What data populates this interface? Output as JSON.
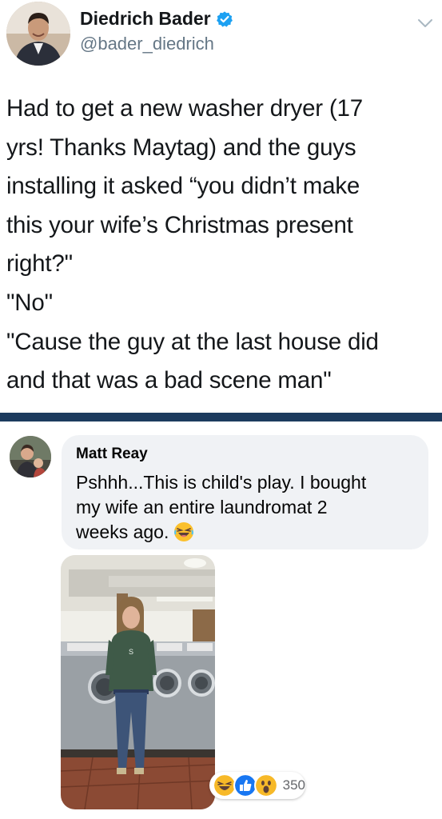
{
  "tweet": {
    "author_name": "Diedrich Bader",
    "handle": "@bader_diedrich",
    "lines": [
      "Had to get a new washer dryer (17",
      "yrs! Thanks Maytag) and the guys",
      "installing it asked “you didn’t make",
      "this your wife’s Christmas present",
      "right?\"",
      "\"No\"",
      "\"Cause the guy at the last house did",
      "and that was a bad scene man\""
    ]
  },
  "comment": {
    "author_name": "Matt Reay",
    "lines": [
      "Pshhh...This is child's play. I bought",
      "my wife an entire laundromat 2",
      "weeks ago."
    ],
    "reaction_count": "350"
  },
  "colors": {
    "divider": "#1c3b5e",
    "verified": "#1da1f2",
    "bubble": "#f0f2f5",
    "like": "#1877f2",
    "haha": "#f7b928"
  },
  "icons": [
    "verified-badge-icon",
    "chevron-down-icon",
    "laughing-emoji-icon",
    "haha-reaction-icon",
    "like-reaction-icon",
    "wow-reaction-icon"
  ]
}
